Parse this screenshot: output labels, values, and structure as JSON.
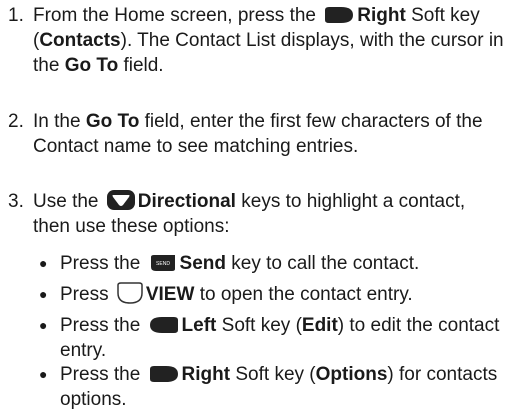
{
  "steps": [
    {
      "num": "1.",
      "a": "From the Home screen, press the",
      "b": "Right",
      "c": "Soft key (",
      "d": "Contacts",
      "e": "). The Contact List displays, with the cursor in the",
      "f": "Go To",
      "g": "field."
    },
    {
      "num": "2.",
      "a": "In the",
      "b": "Go To",
      "c": "field, enter the first few characters of the Contact name to see matching entries."
    },
    {
      "num": "3.",
      "a": "Use the",
      "b": "Directional",
      "c": "keys to highlight a contact, then use these options:"
    }
  ],
  "bullets": [
    {
      "a": "Press the",
      "b": "Send",
      "c": "key to call the contact."
    },
    {
      "a": "Press",
      "b": "VIEW",
      "c": "to open the contact entry."
    },
    {
      "a": "Press the",
      "b": "Left",
      "c": "Soft key (",
      "d": "Edit",
      "e": ") to edit the contact entry."
    },
    {
      "a": "Press the",
      "b": "Right",
      "c": "Soft key (",
      "d": "Options",
      "e": ") for contacts options."
    }
  ],
  "bullet_char": "●",
  "icons": {
    "right_soft_key": "right-soft-key-icon",
    "left_soft_key": "left-soft-key-icon",
    "directional": "directional-key-icon",
    "send": "send-key-icon",
    "view": "view-key-icon",
    "send_label": "SEND"
  },
  "colors": {
    "icon_fill": "#222222",
    "view_fill": "#ffffff"
  }
}
